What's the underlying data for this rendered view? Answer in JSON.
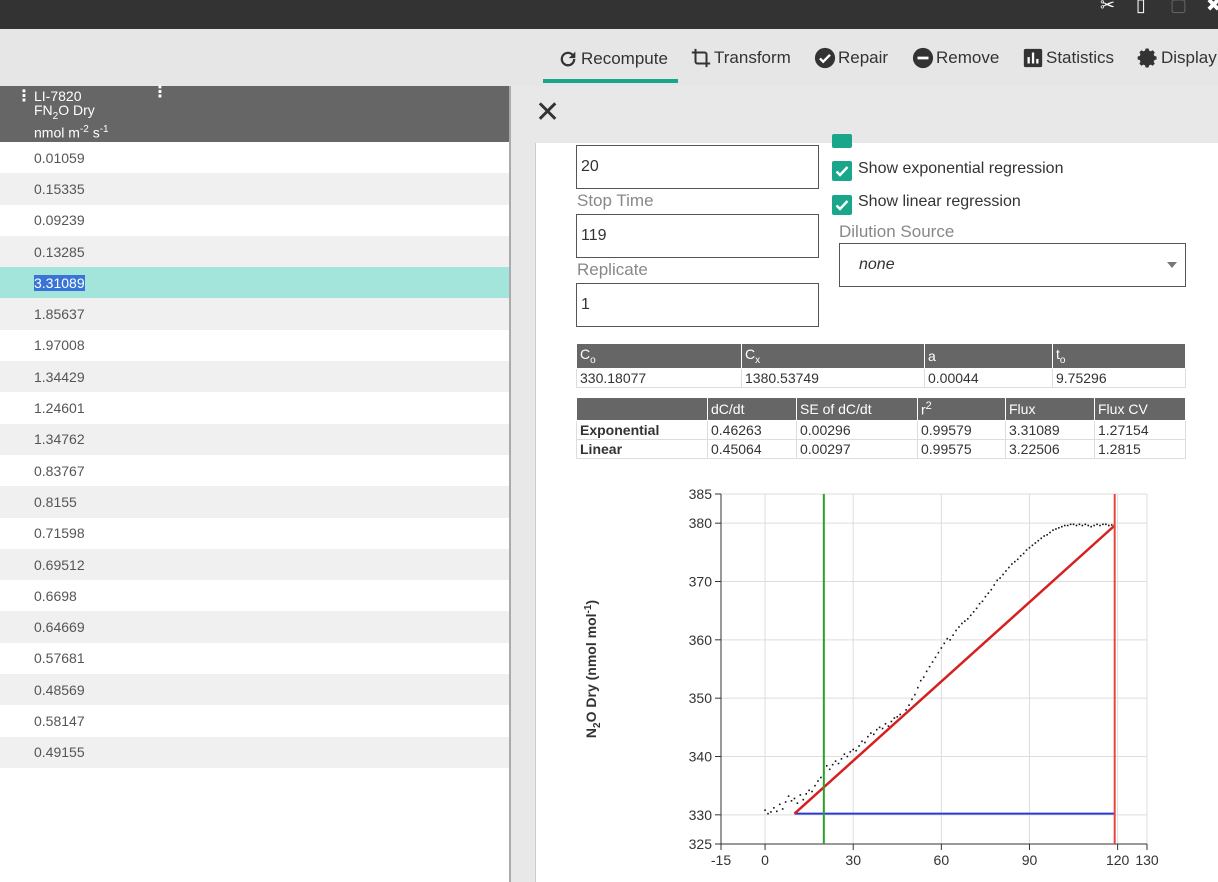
{
  "toolbar": {
    "items": [
      {
        "label": "Recompute",
        "icon": "refresh-icon",
        "active": true
      },
      {
        "label": "Transform",
        "icon": "crop-icon"
      },
      {
        "label": "Repair",
        "icon": "check-circle-icon"
      },
      {
        "label": "Remove",
        "icon": "minus-circle-icon"
      },
      {
        "label": "Statistics",
        "icon": "bar-chart-icon"
      },
      {
        "label": "Display",
        "icon": "gear-icon"
      }
    ],
    "accent_color": "#1aa68a"
  },
  "column": {
    "header_line1": "LI-7820",
    "header_line2_pre": "FN",
    "header_line2_sub": "2",
    "header_line2_post": "O Dry",
    "header_unit_pre": "nmol m",
    "header_unit_sup1": "-2",
    "header_unit_mid": " s",
    "header_unit_sup2": "-1",
    "values": [
      "0.01059",
      "0.15335",
      "0.09239",
      "0.13285",
      "3.31089",
      "1.85637",
      "1.97008",
      "1.34429",
      "1.24601",
      "1.34762",
      "0.83767",
      "0.8155",
      "0.71598",
      "0.69512",
      "0.6698",
      "0.64669",
      "0.57681",
      "0.48569",
      "0.58147",
      "0.49155"
    ],
    "selected_index": 4
  },
  "panel": {
    "start_time_value": "20",
    "stop_time_label": "Stop Time",
    "stop_time_value": "119",
    "replicate_label": "Replicate",
    "replicate_value": "1",
    "show_exp_label": "Show exponential regression",
    "show_lin_label": "Show linear regression",
    "dilution_label": "Dilution Source",
    "dilution_value": "none"
  },
  "params_table": {
    "headers": [
      {
        "main": "C",
        "sub": "o"
      },
      {
        "main": "C",
        "sub": "x"
      },
      {
        "main": "a",
        "sub": ""
      },
      {
        "main": "t",
        "sub": "o"
      }
    ],
    "values": [
      "330.18077",
      "1380.53749",
      "0.00044",
      "9.75296"
    ]
  },
  "regression_table": {
    "headers": [
      "",
      "dC/dt",
      "SE of dC/dt",
      "r",
      "Flux",
      "Flux CV"
    ],
    "r_sup": "2",
    "rows": [
      {
        "name": "Exponential",
        "values": [
          "0.46263",
          "0.00296",
          "0.99579",
          "3.31089",
          "1.27154"
        ]
      },
      {
        "name": "Linear",
        "values": [
          "0.45064",
          "0.00297",
          "0.99575",
          "3.22506",
          "1.2815"
        ]
      }
    ]
  },
  "chart_data": {
    "type": "scatter",
    "ylabel_pre": "N",
    "ylabel_sub": "2",
    "ylabel_mid": "O Dry (nmol mol",
    "ylabel_sup": "-1",
    "ylabel_post": ")",
    "xlim": [
      -15,
      130
    ],
    "ylim": [
      325,
      385
    ],
    "x_ticks": [
      -15,
      0,
      30,
      60,
      90,
      120,
      130
    ],
    "y_ticks": [
      325,
      330,
      340,
      350,
      360,
      370,
      380,
      385
    ],
    "vertical_lines": [
      {
        "x": 20,
        "color": "#2ca02c"
      },
      {
        "x": 119,
        "color": "#e8463c"
      }
    ],
    "baseline": {
      "y": 330.2,
      "x_start": 10,
      "x_end": 119,
      "color": "#2b3bd6"
    },
    "regression_line": {
      "x": [
        10,
        119
      ],
      "y": [
        330.2,
        379.6
      ],
      "color": "#d62020"
    },
    "points": {
      "x": [
        0,
        1,
        2,
        3,
        4,
        5,
        6,
        7,
        8,
        9,
        10,
        11,
        12,
        13,
        14,
        15,
        16,
        17,
        18,
        19,
        20,
        21,
        22,
        23,
        24,
        25,
        26,
        27,
        28,
        29,
        30,
        31,
        32,
        33,
        34,
        35,
        36,
        37,
        38,
        39,
        40,
        41,
        42,
        43,
        44,
        45,
        46,
        47,
        48,
        49,
        50,
        51,
        52,
        53,
        54,
        55,
        56,
        57,
        58,
        59,
        60,
        61,
        62,
        63,
        64,
        65,
        66,
        67,
        68,
        69,
        70,
        71,
        72,
        73,
        74,
        75,
        76,
        77,
        78,
        79,
        80,
        81,
        82,
        83,
        84,
        85,
        86,
        87,
        88,
        89,
        90,
        91,
        92,
        93,
        94,
        95,
        96,
        97,
        98,
        99,
        100,
        101,
        102,
        103,
        104,
        105,
        106,
        107,
        108,
        109,
        110,
        111,
        112,
        113,
        114,
        115,
        116,
        117,
        118,
        119
      ],
      "y": [
        330.8,
        330.2,
        330.5,
        331.2,
        330.6,
        331.8,
        331.0,
        332.2,
        333.2,
        332.4,
        332.8,
        332.0,
        333.4,
        332.6,
        333.6,
        334.2,
        334.0,
        335.0,
        335.8,
        336.4,
        337.2,
        338.4,
        337.8,
        338.6,
        339.2,
        338.8,
        339.6,
        340.4,
        340.0,
        340.8,
        341.2,
        341.0,
        341.8,
        342.6,
        342.4,
        343.4,
        344.0,
        343.8,
        344.6,
        345.0,
        344.8,
        345.6,
        345.2,
        346.0,
        346.6,
        346.8,
        347.2,
        347.0,
        348.0,
        348.8,
        349.8,
        350.6,
        351.8,
        353.0,
        353.6,
        354.6,
        355.4,
        356.2,
        357.0,
        357.8,
        358.6,
        359.4,
        360.2,
        360.0,
        360.8,
        361.6,
        362.2,
        362.8,
        363.2,
        363.6,
        364.2,
        364.8,
        365.4,
        366.2,
        366.6,
        367.4,
        368.0,
        368.6,
        369.4,
        370.2,
        370.6,
        371.2,
        371.8,
        372.4,
        373.0,
        373.4,
        373.8,
        374.4,
        374.8,
        375.4,
        375.8,
        376.2,
        376.6,
        377.0,
        377.4,
        377.8,
        378.0,
        378.4,
        378.8,
        379.0,
        379.2,
        379.4,
        379.6,
        379.6,
        379.8,
        379.8,
        379.6,
        379.8,
        379.6,
        379.8,
        379.6,
        379.4,
        379.6,
        379.8,
        379.6,
        379.8,
        379.8,
        379.6,
        379.7,
        379.8
      ]
    }
  }
}
